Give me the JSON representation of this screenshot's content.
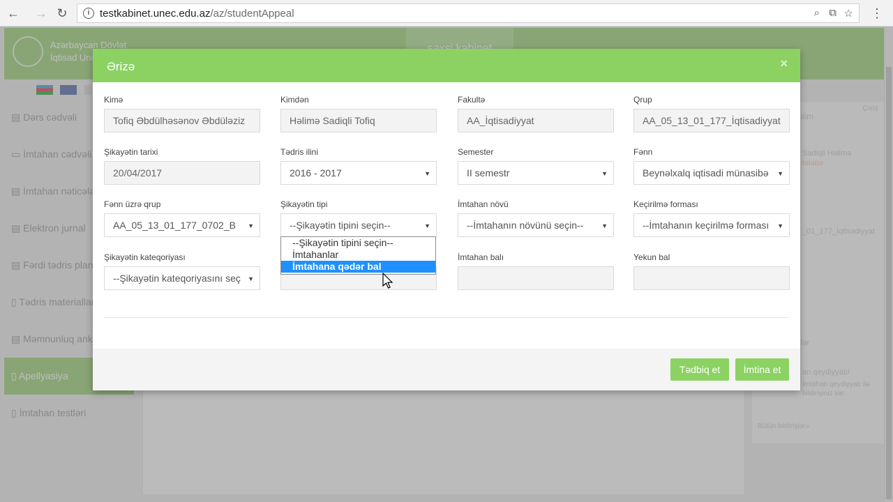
{
  "browser": {
    "url_host": "testkabinet.unec.edu.az",
    "url_path": "/az/studentAppeal"
  },
  "background": {
    "logo_line1": "Azərbaycan Dövlət",
    "logo_line2": "İqtisad Universiteti",
    "header_tab": "şəxsi kabinet",
    "sidebar": [
      {
        "label": "Dərs cədvəli",
        "icon": "table-icon"
      },
      {
        "label": "İmtahan cədvəli",
        "icon": "monitor-icon"
      },
      {
        "label": "İmtahan nəticələri",
        "icon": "table-icon"
      },
      {
        "label": "Elektron jurnal",
        "icon": "table-icon"
      },
      {
        "label": "Fərdi tədris planı",
        "icon": "table-icon"
      },
      {
        "label": "Tədris materialları",
        "icon": "document-icon"
      },
      {
        "label": "Məmnunluq anketi",
        "icon": "table-icon"
      },
      {
        "label": "Apellyasiya",
        "icon": "document-icon"
      },
      {
        "label": "İmtahan testləri",
        "icon": "document-icon"
      }
    ],
    "right_panel": {
      "tab1": "ilim",
      "tab2": "Çıxış",
      "user_name": "Sadiqli Həlimə",
      "user_role": "tələbə",
      "group": "_01_177_İqtisadiyyat",
      "notif_header": "lər",
      "notif_title": "an qeydiyyatı!",
      "notif_body1": "İmtahan qeydiyyatı ilə",
      "notif_body2": "bildirişiniz var.",
      "all_notifs": "Bütün bildirişlər»"
    }
  },
  "modal": {
    "title": "Ərizə",
    "close": "×",
    "fields": {
      "kime": {
        "label": "Kimə",
        "value": "Tofiq Əbdülhəsənov Əbdüləziz"
      },
      "kimden": {
        "label": "Kimdən",
        "value": "Həlimə Sadiqli Tofiq"
      },
      "fakulte": {
        "label": "Fakultə",
        "value": "AA_İqtisadiyyat"
      },
      "qrup": {
        "label": "Qrup",
        "value": "AA_05_13_01_177_İqtisadiyyat"
      },
      "sikayet_tarixi": {
        "label": "Şikayətin tarixi",
        "value": "20/04/2017"
      },
      "tedris_ili": {
        "label": "Tədris ilini",
        "value": "2016 - 2017"
      },
      "semester": {
        "label": "Semester",
        "value": "II semestr"
      },
      "fenn": {
        "label": "Fənn",
        "value": "Beynəlxalq iqtisadi münasibə"
      },
      "fenn_qrup": {
        "label": "Fənn üzrə qrup",
        "value": "AA_05_13_01_177_0702_B"
      },
      "sikayet_tipi": {
        "label": "Şikayətin tipi",
        "value": "--Şikayətin tipini seçin--"
      },
      "imtahan_novu": {
        "label": "İmtahan növü",
        "value": "--İmtahanın növünü seçin--"
      },
      "kecirilme_formasi": {
        "label": "Keçirilmə forması",
        "value": "--İmtahanın keçirilmə forması"
      },
      "sikayet_kateqoriyasi": {
        "label": "Şikayətin kateqoriyası",
        "value": "--Şikayətin kateqoriyasını seç"
      },
      "imtahan_bali": {
        "label": "İmtahan balı",
        "value": ""
      },
      "yekun_bal": {
        "label": "Yekun bal",
        "value": ""
      }
    },
    "dropdown_options": [
      "--Şikayətin tipini seçin--",
      "İmtahanlar",
      "İmtahana qədər bal"
    ],
    "dropdown_selected_index": 2,
    "buttons": {
      "apply": "Tədbiq et",
      "cancel": "İmtina et"
    }
  },
  "colors": {
    "accent": "#8bd263",
    "selection": "#1e90ff"
  }
}
